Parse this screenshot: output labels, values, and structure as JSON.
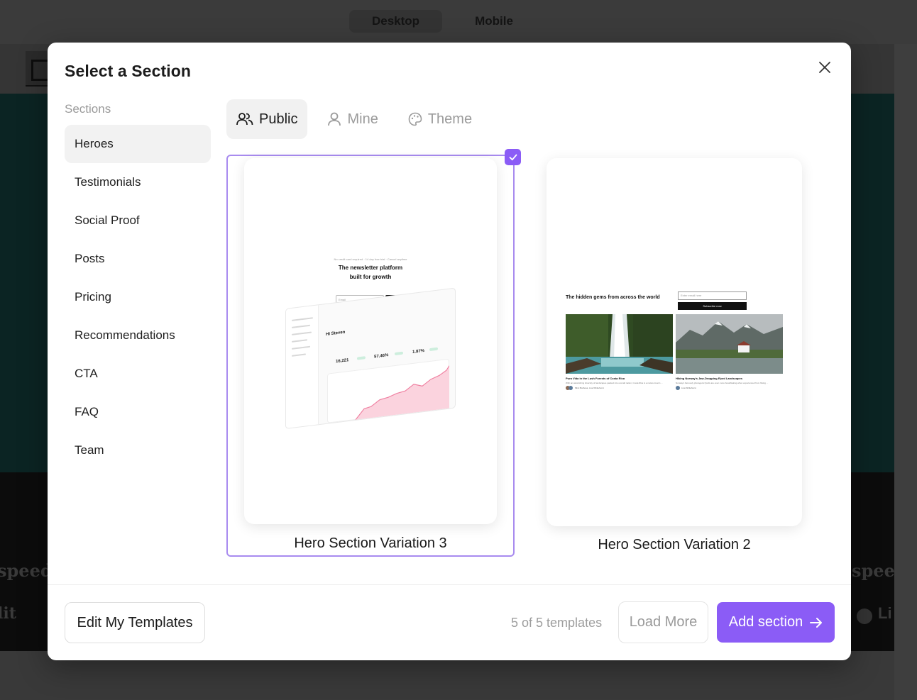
{
  "device_toggle": {
    "desktop": "Desktop",
    "mobile": "Mobile",
    "active": "Desktop"
  },
  "background": {
    "logo_words": [
      "speed",
      "lit",
      "speed",
      "Li"
    ]
  },
  "modal": {
    "title": "Select a Section",
    "sidebar_heading": "Sections",
    "sections": [
      {
        "label": "Heroes",
        "active": true
      },
      {
        "label": "Testimonials",
        "active": false
      },
      {
        "label": "Social Proof",
        "active": false
      },
      {
        "label": "Posts",
        "active": false
      },
      {
        "label": "Pricing",
        "active": false
      },
      {
        "label": "Recommendations",
        "active": false
      },
      {
        "label": "CTA",
        "active": false
      },
      {
        "label": "FAQ",
        "active": false
      },
      {
        "label": "Team",
        "active": false
      }
    ],
    "tabs": [
      {
        "label": "Public",
        "icon": "users-icon",
        "active": true
      },
      {
        "label": "Mine",
        "icon": "user-icon",
        "active": false
      },
      {
        "label": "Theme",
        "icon": "palette-icon",
        "active": false
      }
    ],
    "templates": [
      {
        "name": "Hero Section Variation 3",
        "selected": true,
        "preview": {
          "tagline": "No credit card required · 14 day free trial · Cancel anytime",
          "headline_line1": "The newsletter platform",
          "headline_line2": "built for growth",
          "email_placeholder": "Email",
          "subscribe_label": "Subscribe",
          "dashboard_greeting": "Hi Steven",
          "stat_1": "16,221",
          "stat_2": "57.46%",
          "stat_3": "1.87%"
        }
      },
      {
        "name": "Hero Section Variation 2",
        "selected": false,
        "preview": {
          "headline": "The hidden gems from across the world",
          "email_placeholder": "Enter email here",
          "subscribe_label": "Subscribe now",
          "post_1_title": "Pura Vida in the Lush Forests of Costa Rica",
          "post_1_excerpt": "With an astonishing diversity of landscapes packed into a small nation, Costa Rica is a nature lover's ...",
          "post_1_authors": "Mimi Barbosa, Lisa Whitehurst",
          "post_2_title": "Hiking Norway's Jaw-Dropping Fjord Landscapes",
          "post_2_excerpt": "Norway's famously photogenic fjords are even more breathtaking when experienced from hiking ...",
          "post_2_authors": "Lisa Whitehurst"
        }
      }
    ],
    "footer": {
      "edit_templates_label": "Edit My Templates",
      "count_text": "5 of 5 templates",
      "load_more_label": "Load More",
      "add_section_label": "Add section"
    }
  },
  "colors": {
    "accent": "#8b5cf6",
    "selected_border": "#a88bef",
    "active_bg": "#f2f2f2"
  }
}
